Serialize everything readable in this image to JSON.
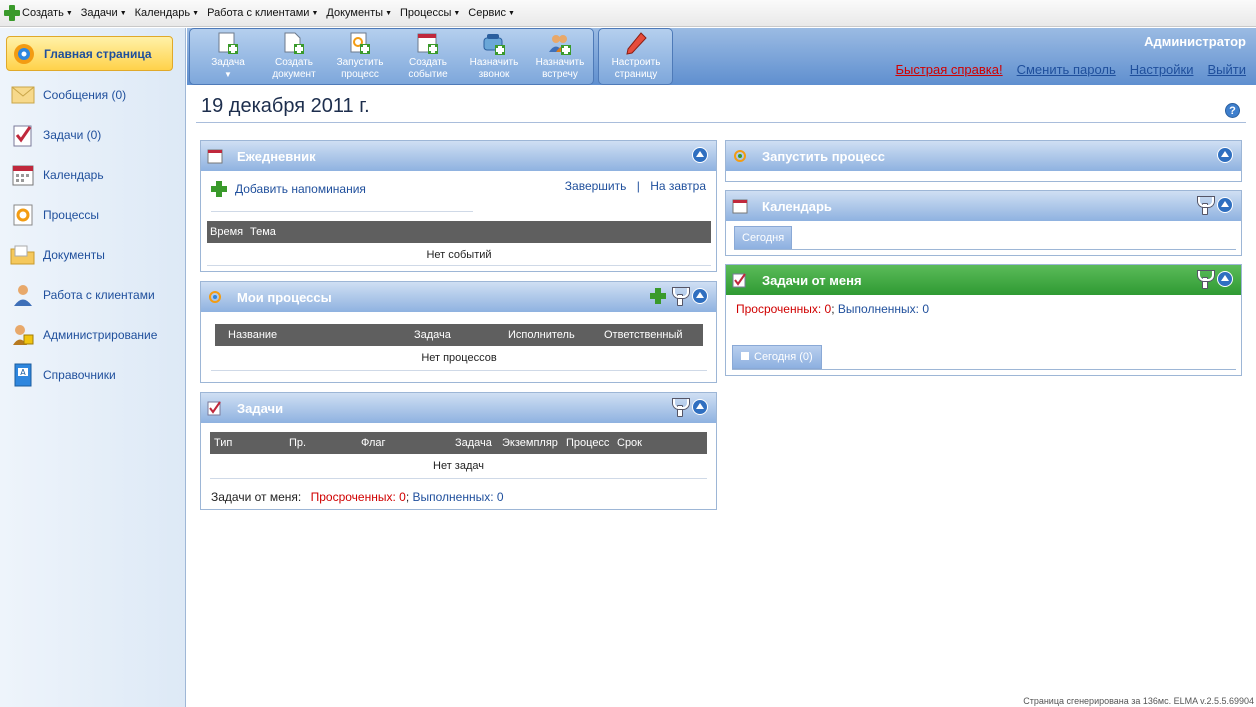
{
  "topmenu": {
    "items": [
      "Создать",
      "Задачи",
      "Календарь",
      "Работа с клиентами",
      "Документы",
      "Процессы",
      "Сервис"
    ]
  },
  "sidebar": {
    "items": [
      {
        "label": "Главная страница",
        "icon": "home-icon"
      },
      {
        "label": "Сообщения (0)",
        "icon": "envelope-icon"
      },
      {
        "label": "Задачи (0)",
        "icon": "task-check-icon"
      },
      {
        "label": "Календарь",
        "icon": "calendar-icon"
      },
      {
        "label": "Процессы",
        "icon": "process-icon"
      },
      {
        "label": "Документы",
        "icon": "folder-icon"
      },
      {
        "label": "Работа с клиентами",
        "icon": "client-icon"
      },
      {
        "label": "Администрирование",
        "icon": "admin-lock-icon"
      },
      {
        "label": "Справочники",
        "icon": "reference-book-icon"
      }
    ]
  },
  "toolbar": {
    "task": "Задача",
    "create_doc": "Создать документ",
    "start_process": "Запустить процесс",
    "create_event": "Создать событие",
    "assign_call": "Назначить звонок",
    "assign_meeting": "Назначить встречу",
    "configure_page": "Настроить страницу"
  },
  "header": {
    "user": "Администратор",
    "links": {
      "quick_help": "Быстрая справка!",
      "change_password": "Сменить пароль",
      "settings": "Настройки",
      "logout": "Выйти"
    }
  },
  "page": {
    "date": "19 декабря 2011 г.",
    "help": "?"
  },
  "diary": {
    "title": "Ежедневник",
    "add_reminder": "Добавить напоминания",
    "finish": "Завершить",
    "separator": "|",
    "tomorrow": "На завтра",
    "columns": [
      "Время",
      "Тема"
    ],
    "empty": "Нет событий"
  },
  "processes": {
    "title": "Мои процессы",
    "columns": [
      "Название",
      "Задача",
      "Исполнитель",
      "Ответственный"
    ],
    "empty": "Нет процессов"
  },
  "tasks": {
    "title": "Задачи",
    "columns": [
      "Тип",
      "Пр.",
      "Флаг",
      "Задача",
      "Экземпляр",
      "Процесс",
      "Срок"
    ],
    "empty": "Нет задач",
    "from_me_label": "Задачи от меня:",
    "overdue": "Просроченных:",
    "overdue_count": "0",
    "done": "Выполненных:",
    "done_count": "0",
    "semicolon": ";"
  },
  "start_process": {
    "title": "Запустить процесс"
  },
  "calendar": {
    "title": "Календарь",
    "today_tab": "Сегодня"
  },
  "my_tasks": {
    "title": "Задачи от меня",
    "overdue": "Просроченных:",
    "overdue_count": "0",
    "done": "Выполненных:",
    "done_count": "0",
    "semicolon": ";",
    "today": "Сегодня (0)"
  },
  "footer": "Страница сгенерирована за 136мс. ELMA v.2.5.5.69904",
  "colors": {
    "header_blue": "#5f8fcf",
    "portlet_header": "#8fb2e0",
    "green_header": "#2f9a33",
    "active_nav": "#ffd24a",
    "link_red": "#d00000",
    "link_blue": "#1f4f9c"
  }
}
